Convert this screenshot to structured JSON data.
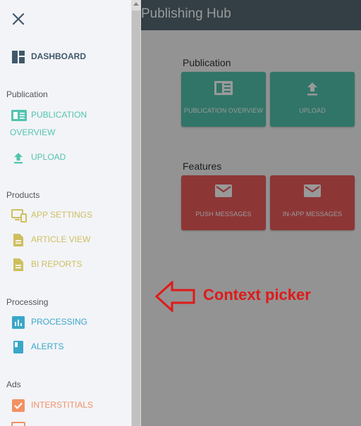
{
  "app": {
    "title": "Publishing Hub"
  },
  "main": {
    "sections": [
      {
        "title": "Publication",
        "tiles": [
          {
            "label": "PUBLICATION OVERVIEW",
            "icon": "publication-overview-icon"
          },
          {
            "label": "UPLOAD",
            "icon": "upload-icon"
          }
        ]
      },
      {
        "title": "Features",
        "tiles": [
          {
            "label": "PUSH MESSAGES",
            "icon": "envelope-icon"
          },
          {
            "label": "IN-APP MESSAGES",
            "icon": "envelope-icon"
          }
        ]
      }
    ]
  },
  "drawer": {
    "dashboard": "DASHBOARD",
    "groups": [
      {
        "title": "Publication",
        "items": [
          "PUBLICATION OVERVIEW",
          "UPLOAD"
        ]
      },
      {
        "title": "Products",
        "items": [
          "APP SETTINGS",
          "ARTICLE VIEW",
          "BI REPORTS"
        ]
      },
      {
        "title": "Processing",
        "items": [
          "PROCESSING",
          "ALERTS"
        ]
      },
      {
        "title": "Ads",
        "items": [
          "INTERSTITIALS"
        ]
      }
    ]
  },
  "annotation": {
    "text": "Context picker"
  },
  "colors": {
    "appbar": "#566a74",
    "teal": "#52c4ae",
    "red": "#ec5b5b",
    "olive": "#cdbf60",
    "blue": "#3aa7c9",
    "orange": "#f29163",
    "annotation": "#e01919"
  }
}
